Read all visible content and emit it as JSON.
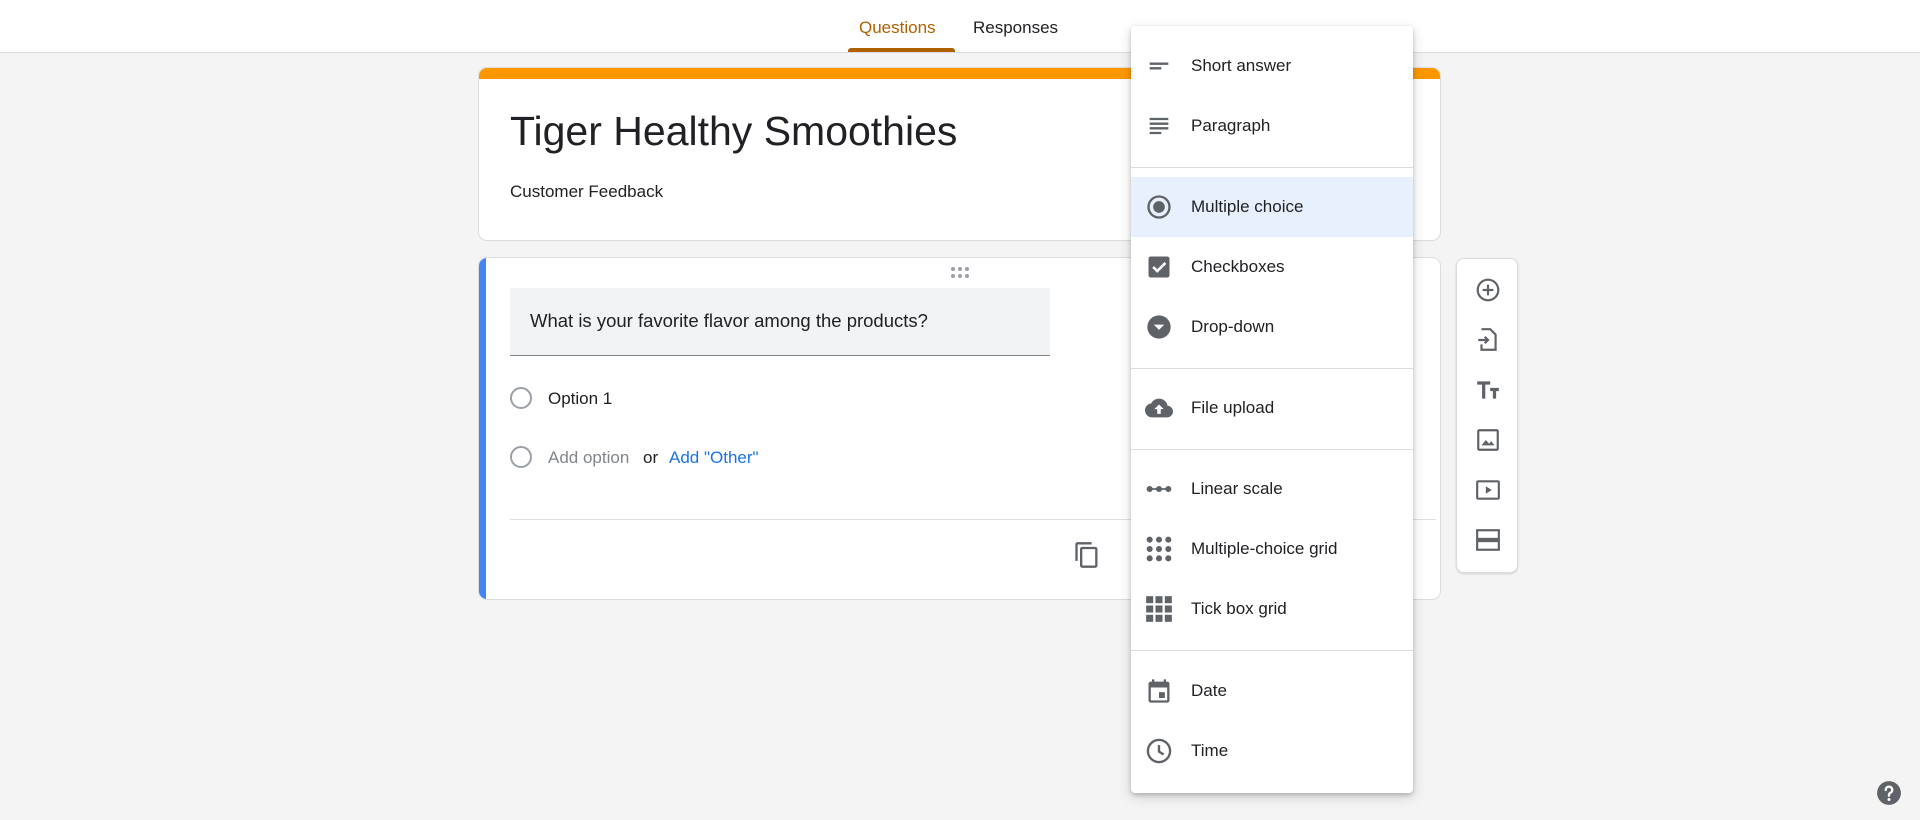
{
  "tabs": {
    "questions": "Questions",
    "responses": "Responses"
  },
  "form": {
    "title": "Tiger Healthy Smoothies",
    "description": "Customer Feedback"
  },
  "question": {
    "title": "What is your favorite flavor among the products?",
    "option1": "Option 1",
    "add_option": "Add option",
    "or": "or",
    "add_other": "Add \"Other\""
  },
  "menu": {
    "short_answer": "Short answer",
    "paragraph": "Paragraph",
    "multiple_choice": "Multiple choice",
    "checkboxes": "Checkboxes",
    "dropdown": "Drop-down",
    "file_upload": "File upload",
    "linear_scale": "Linear scale",
    "multiple_choice_grid": "Multiple-choice grid",
    "tick_box_grid": "Tick box grid",
    "date": "Date",
    "time": "Time",
    "selected": "Multiple choice"
  },
  "toolbar_icons": [
    "add-question-icon",
    "import-questions-icon",
    "add-title-icon",
    "add-image-icon",
    "add-video-icon",
    "add-section-icon"
  ],
  "colors": {
    "theme_accent": "#ff9800",
    "active_tab": "#b06000",
    "question_accent": "#4285f4",
    "link_blue": "#1a73e8",
    "selected_item_bg": "#e8f0fe"
  }
}
